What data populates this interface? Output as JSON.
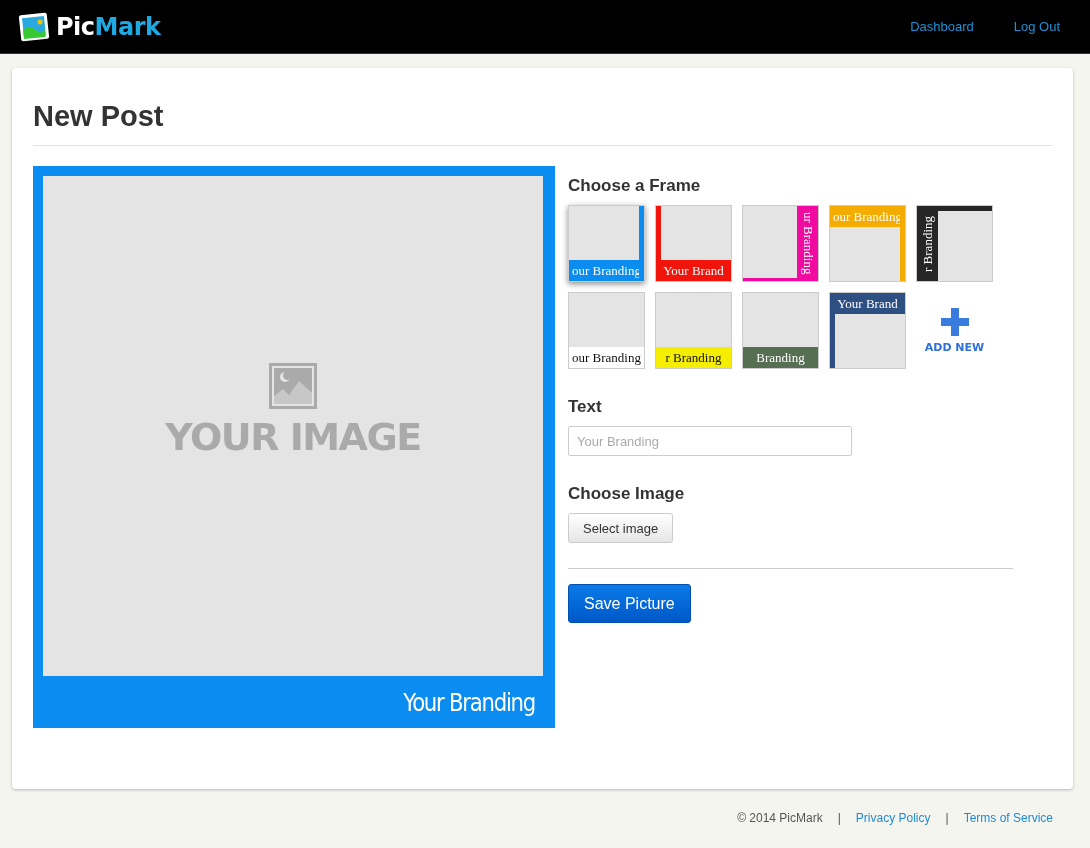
{
  "header": {
    "logo": {
      "first": "Pic",
      "second": "Mark"
    },
    "nav": [
      "Dashboard",
      "Log Out"
    ]
  },
  "page": {
    "title": "New Post"
  },
  "preview": {
    "placeholder": "YOUR IMAGE",
    "branding": "Your Branding"
  },
  "frames_section": {
    "heading": "Choose a Frame",
    "add_label": "ADD NEW",
    "frames": [
      {
        "kind": "bottom-right",
        "color": "#0a8cf0",
        "text": "our Branding",
        "selected": true
      },
      {
        "kind": "bottom-left",
        "color": "#f0140a",
        "text": "Your Brand",
        "selected": false
      },
      {
        "kind": "right-bottom",
        "color": "#f00aa0",
        "text": "ur Branding",
        "selected": false
      },
      {
        "kind": "top-right",
        "color": "#f5ac00",
        "text": "our Branding",
        "selected": false
      },
      {
        "kind": "left-top",
        "color": "#262626",
        "text": "r Branding",
        "selected": false
      },
      {
        "kind": "bottom",
        "color": "#ffffff",
        "text": "our Branding",
        "selected": false
      },
      {
        "kind": "bottom",
        "color": "#f5ee00",
        "text": "r Branding",
        "selected": false
      },
      {
        "kind": "bottom",
        "color": "#566e52",
        "text": "Branding",
        "selected": false
      },
      {
        "kind": "top-left",
        "color": "#2e4f82",
        "text": "Your Brand",
        "selected": false
      }
    ]
  },
  "text_section": {
    "heading": "Text",
    "placeholder": "Your Branding"
  },
  "image_section": {
    "heading": "Choose Image",
    "button": "Select image"
  },
  "save_button": "Save Picture",
  "footer": [
    {
      "kind": "text",
      "text": "© 2014 PicMark"
    },
    {
      "kind": "separator",
      "text": "|"
    },
    {
      "kind": "link",
      "text": "Privacy Policy"
    },
    {
      "kind": "separator",
      "text": "|"
    },
    {
      "kind": "link",
      "text": "Terms of Service"
    }
  ]
}
